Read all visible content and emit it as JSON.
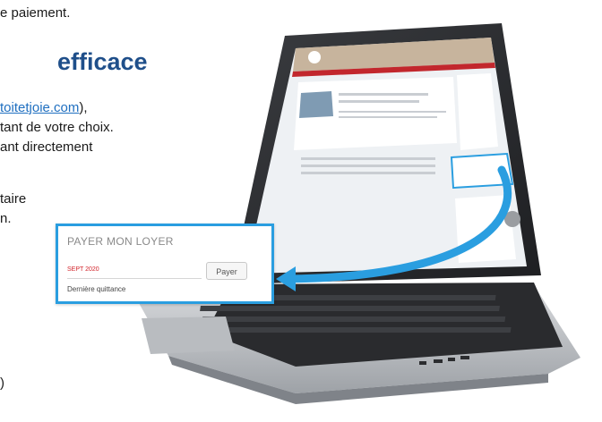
{
  "text": {
    "line1": "e paiement.",
    "heading": "efficace",
    "line2_link": "toitetjoie.com",
    "line2_suffix": "),",
    "line3": "tant de votre choix.",
    "line4": "ant directement",
    "line5": "taire",
    "line6": "n.",
    "line7": ")"
  },
  "popup": {
    "title": "PAYER MON LOYER",
    "date": "SEPT 2020",
    "button": "Payer",
    "receipt": "Dernière quittance"
  },
  "colors": {
    "heading": "#1f4f8a",
    "accent": "#2a9ee0",
    "date_red": "#d2232a",
    "screen_bg": "#eef1f4"
  }
}
